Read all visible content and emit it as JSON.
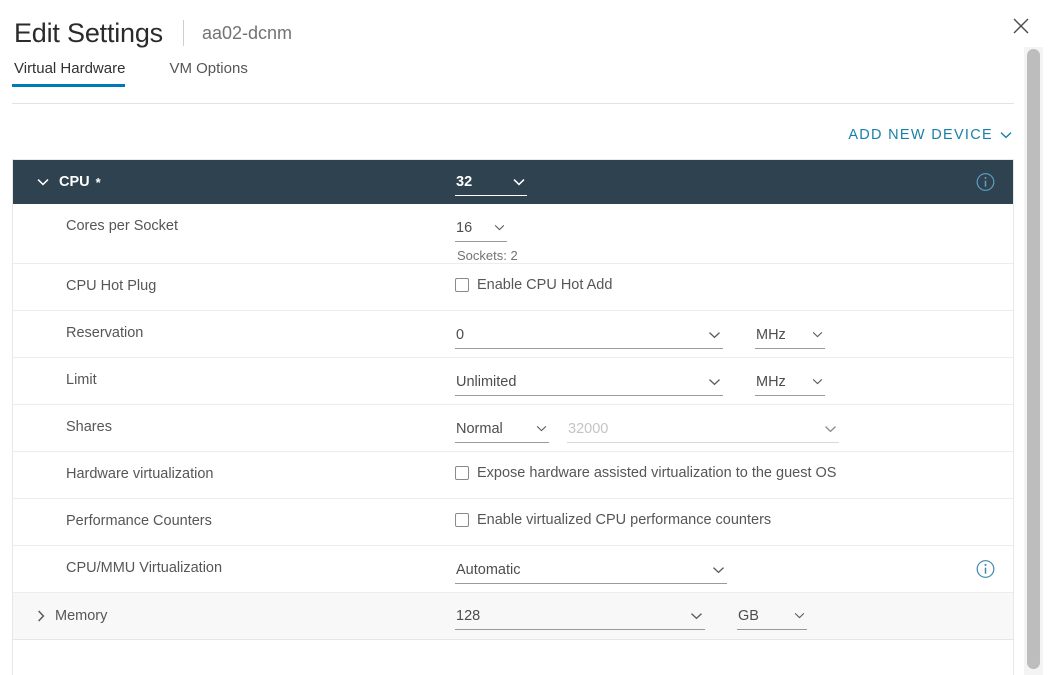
{
  "window": {
    "title": "Edit Settings",
    "subject": "aa02-dcnm",
    "close_label": "close-icon"
  },
  "tabs": [
    {
      "label": "Virtual Hardware",
      "active": true
    },
    {
      "label": "VM Options",
      "active": false
    }
  ],
  "toolbar": {
    "add_new_device": "ADD NEW DEVICE"
  },
  "colors": {
    "accent": "#0079b8",
    "link": "#1a80a9",
    "header_band": "#2e4250",
    "info_icon": "#4f9dc0",
    "memory_row_bg": "#f8f8f8"
  },
  "sections": {
    "cpu": {
      "label": "CPU",
      "required_marker": "*",
      "expanded": true,
      "value": "32",
      "rows": {
        "cores_per_socket": {
          "label": "Cores per Socket",
          "value": "16",
          "sockets_text": "Sockets: 2"
        },
        "cpu_hot_plug": {
          "label": "CPU Hot Plug",
          "checkbox_label": "Enable CPU Hot Add",
          "checked": false
        },
        "reservation": {
          "label": "Reservation",
          "value": "0",
          "unit": "MHz"
        },
        "limit": {
          "label": "Limit",
          "value": "Unlimited",
          "unit": "MHz"
        },
        "shares": {
          "label": "Shares",
          "value": "Normal",
          "amount": "32000",
          "amount_disabled": true
        },
        "hardware_virtualization": {
          "label": "Hardware virtualization",
          "checkbox_label": "Expose hardware assisted virtualization to the guest OS",
          "checked": false
        },
        "performance_counters": {
          "label": "Performance Counters",
          "checkbox_label": "Enable virtualized CPU performance counters",
          "checked": false
        },
        "cpu_mmu_virtualization": {
          "label": "CPU/MMU Virtualization",
          "value": "Automatic"
        }
      }
    },
    "memory": {
      "label": "Memory",
      "expanded": false,
      "value": "128",
      "unit": "GB"
    }
  }
}
